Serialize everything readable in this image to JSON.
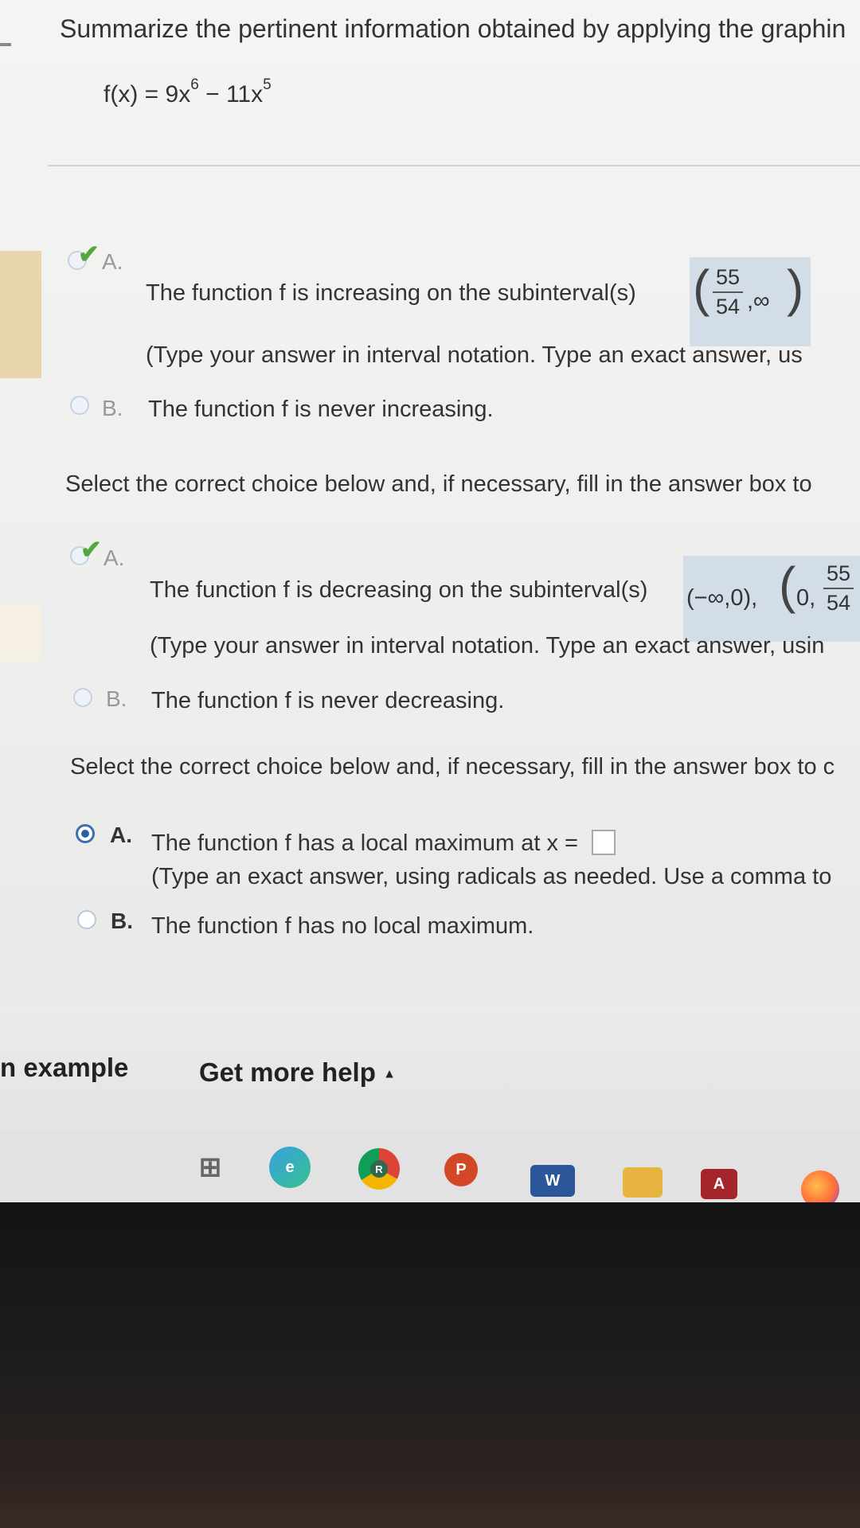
{
  "header": {
    "instruction": "Summarize the pertinent information obtained by applying the graphin",
    "formula_prefix": "f(x) = 9x",
    "formula_exp1": "6",
    "formula_mid": " − 11x",
    "formula_exp2": "5"
  },
  "increasing": {
    "choice_a_letter": "A.",
    "choice_a_text": "The function f is increasing on the subinterval(s)",
    "answer_num": "55",
    "answer_den": "54",
    "answer_tail": ",∞",
    "hint": "(Type your answer in interval notation. Type an exact answer, us",
    "choice_b_letter": "B.",
    "choice_b_text": "The function f is never increasing."
  },
  "decreasing": {
    "prompt": "Select the correct choice below and, if necessary, fill in the answer box to",
    "choice_a_letter": "A.",
    "choice_a_text": "The function f is decreasing on the subinterval(s)",
    "answer_part1": "(−∞,0),",
    "answer_part2": "0,",
    "answer_num": "55",
    "answer_den": "54",
    "hint": "(Type your answer in interval notation. Type an exact answer, usin",
    "choice_b_letter": "B.",
    "choice_b_text": "The function f is never decreasing."
  },
  "local_max": {
    "prompt": "Select the correct choice below and, if necessary, fill in the answer box to c",
    "choice_a_letter": "A.",
    "choice_a_text": "The function f has a local maximum at x =",
    "choice_a_hint": "(Type an exact answer, using radicals as needed. Use a comma to",
    "choice_b_letter": "B.",
    "choice_b_text": "The function f has no local maximum."
  },
  "footer": {
    "example_link": "n example",
    "help_link": "Get more help",
    "help_arrow": "▲"
  },
  "taskbar": {
    "chrome_badge": "R",
    "powerpoint_letter": "P",
    "word_letter": "W",
    "access_letter": "A"
  }
}
